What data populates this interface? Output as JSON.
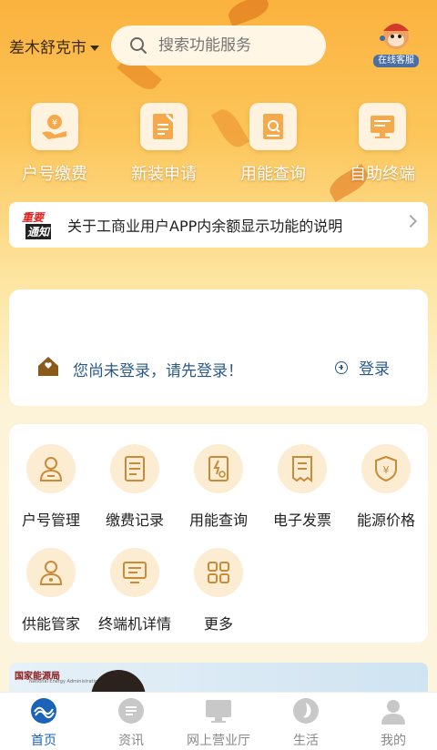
{
  "header": {
    "city": "差木舒克市",
    "search_placeholder": "搜索功能服务",
    "customer_service_label": "在线客服"
  },
  "quick_actions": [
    {
      "label": "户号缴费",
      "icon": "hand-yen-icon"
    },
    {
      "label": "新装申请",
      "icon": "wrench-doc-icon"
    },
    {
      "label": "用能查询",
      "icon": "doc-search-icon"
    },
    {
      "label": "自助终端",
      "icon": "monitor-icon"
    }
  ],
  "notice": {
    "badge_top": "重要",
    "badge_bottom": "通知",
    "text": "关于工商业用户APP内余额显示功能的说明"
  },
  "login": {
    "message": "您尚未登录，请先登录！",
    "button": "登录"
  },
  "services": [
    {
      "label": "户号管理",
      "icon": "person-icon"
    },
    {
      "label": "缴费记录",
      "icon": "record-doc-icon"
    },
    {
      "label": "用能查询",
      "icon": "lightning-search-icon"
    },
    {
      "label": "电子发票",
      "icon": "invoice-icon"
    },
    {
      "label": "能源价格",
      "icon": "shield-yen-icon"
    },
    {
      "label": "供能管家",
      "icon": "steward-icon"
    },
    {
      "label": "终端机详情",
      "icon": "terminal-icon"
    },
    {
      "label": "更多",
      "icon": "grid-icon"
    }
  ],
  "banner": {
    "org": "国家能源局",
    "org_en": "National Energy Administration"
  },
  "tabbar": [
    {
      "label": "首页",
      "icon": "home-logo-icon",
      "active": true
    },
    {
      "label": "资讯",
      "icon": "news-icon",
      "active": false
    },
    {
      "label": "网上营业厅",
      "icon": "service-hall-icon",
      "active": false
    },
    {
      "label": "生活",
      "icon": "life-icon",
      "active": false
    },
    {
      "label": "我的",
      "icon": "profile-icon",
      "active": false
    }
  ],
  "colors": {
    "accent_orange": "#f7a932",
    "link_blue": "#2a5a8a",
    "tab_active": "#1a63b8"
  }
}
